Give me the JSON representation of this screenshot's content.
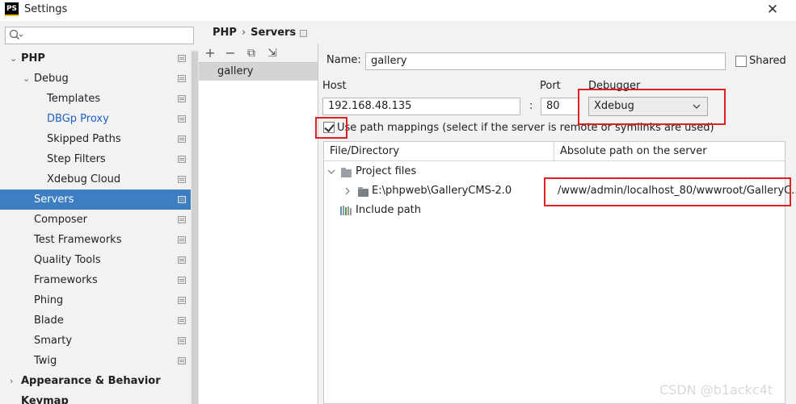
{
  "window": {
    "title": "Settings",
    "logo_text": "PS",
    "close": "✕"
  },
  "search": {
    "placeholder": "Q▾"
  },
  "sidebar": {
    "items": [
      {
        "label": "PHP",
        "chevron": "⌄",
        "bold": true
      },
      {
        "label": "Debug",
        "chevron": "⌄"
      },
      {
        "label": "Templates"
      },
      {
        "label": "DBGp Proxy",
        "link": true
      },
      {
        "label": "Skipped Paths"
      },
      {
        "label": "Step Filters"
      },
      {
        "label": "Xdebug Cloud"
      },
      {
        "label": "Servers",
        "selected": true
      },
      {
        "label": "Composer"
      },
      {
        "label": "Test Frameworks"
      },
      {
        "label": "Quality Tools"
      },
      {
        "label": "Frameworks"
      },
      {
        "label": "Phing"
      },
      {
        "label": "Blade"
      },
      {
        "label": "Smarty"
      },
      {
        "label": "Twig"
      },
      {
        "label": "Appearance & Behavior",
        "chevron": "›",
        "bold": true
      },
      {
        "label": "Keymap",
        "bold": true
      }
    ]
  },
  "breadcrumb": {
    "parent": "PHP",
    "separator": "›",
    "current": "Servers"
  },
  "toolbar": {
    "add": "+",
    "remove": "−",
    "copy": "⧉",
    "import": "⇲"
  },
  "servers": [
    "gallery"
  ],
  "form": {
    "name_label": "Name:",
    "name_value": "gallery",
    "shared_label": "Shared",
    "host_label": "Host",
    "host_value": "192.168.48.135",
    "colon": ":",
    "port_label": "Port",
    "port_value": "80",
    "debugger_label": "Debugger",
    "debugger_value": "Xdebug",
    "use_path_mappings_label": "Use path mappings (select if the server is remote or symlinks are used)"
  },
  "mapping": {
    "col_file": "File/Directory",
    "col_server": "Absolute path on the server",
    "project_files": "Project files",
    "local_path": "E:\\phpweb\\GalleryCMS-2.0",
    "server_path": "/www/admin/localhost_80/wwwroot/GalleryC...",
    "include_path": "Include path"
  },
  "watermark": "CSDN @b1ackc4t",
  "colors": {
    "selection": "#3d7dc1",
    "highlight_box": "#e02020",
    "link": "#1f5fc8"
  }
}
